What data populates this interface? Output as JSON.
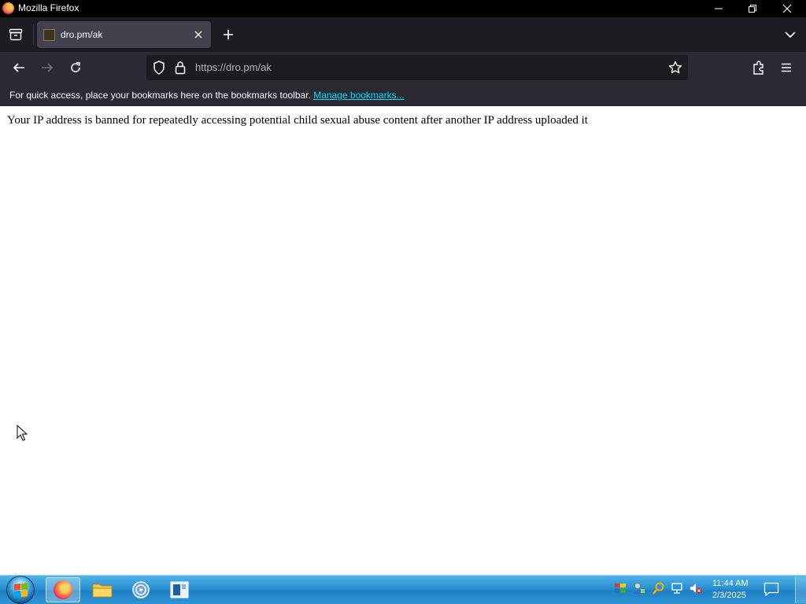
{
  "window": {
    "title": "Mozilla Firefox"
  },
  "tab": {
    "title": "dro.pm/ak"
  },
  "urlbar": {
    "url": "https://dro.pm/ak"
  },
  "bookmarks_bar": {
    "message": "For quick access, place your bookmarks here on the bookmarks toolbar.",
    "manage_link": "Manage bookmarks..."
  },
  "page": {
    "text": "Your IP address is banned for repeatedly accessing potential child sexual abuse content after another IP address uploaded it"
  },
  "taskbar": {
    "apps": [
      "firefox-icon",
      "file-explorer-icon",
      "disc-app-icon",
      "window-app-icon"
    ],
    "clock": {
      "time": "11:44 AM",
      "date": "2/3/2025"
    }
  },
  "colors": {
    "toolbar_bg": "#2b2a33",
    "tabstrip_bg": "#1c1b22",
    "link": "#00ddff",
    "taskbar": "#2a8fd1"
  }
}
